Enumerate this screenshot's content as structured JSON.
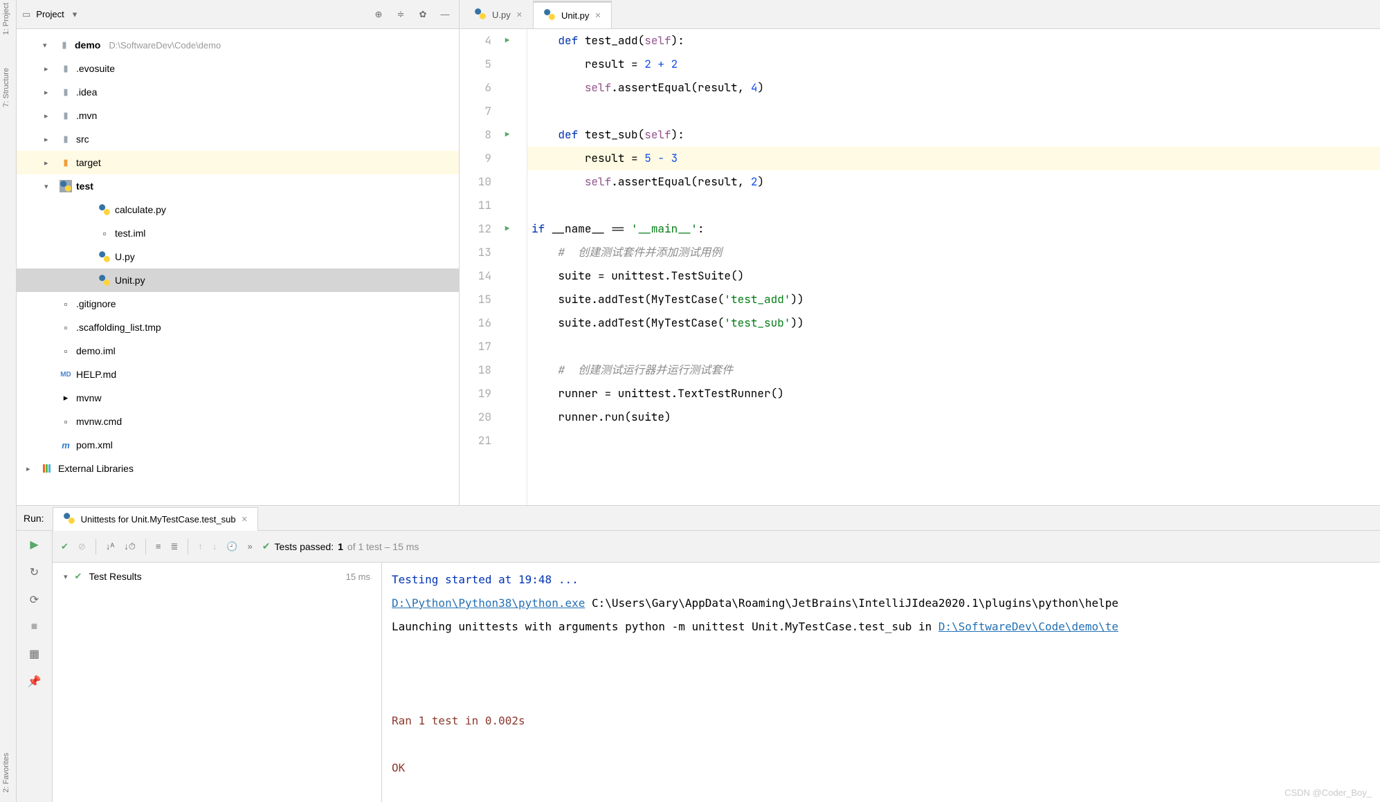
{
  "sidebar_tabs": {
    "project": "1: Project",
    "structure": "7: Structure",
    "favorites": "2: Favorites"
  },
  "project": {
    "toolbar_label": "Project",
    "root": "demo",
    "root_path": "D:\\SoftwareDev\\Code\\demo",
    "dirs": {
      "evosuite": ".evosuite",
      "idea": ".idea",
      "mvn": ".mvn",
      "src": "src",
      "target": "target",
      "test": "test"
    },
    "files": {
      "calculate": "calculate.py",
      "testiml": "test.iml",
      "u": "U.py",
      "unit": "Unit.py",
      "gitignore": ".gitignore",
      "scaffolding": ".scaffolding_list.tmp",
      "demoiml": "demo.iml",
      "help": "HELP.md",
      "mvnw": "mvnw",
      "mvnwcmd": "mvnw.cmd",
      "pom": "pom.xml"
    },
    "ext_libs": "External Libraries"
  },
  "tabs": {
    "u": "U.py",
    "unit": "Unit.py"
  },
  "code": {
    "l4": {
      "def": "def ",
      "name": "test_add",
      "open": "(",
      "self": "self",
      "rest": "):"
    },
    "l5": {
      "txt": "result = ",
      "op": "2 + 2"
    },
    "l6": {
      "self": "self",
      "rest": ".assertEqual(result, ",
      "num": "4",
      "end": ")"
    },
    "l8": {
      "def": "def ",
      "name": "test_sub",
      "open": "(",
      "self": "self",
      "rest": "):"
    },
    "l9": {
      "txt": "result = ",
      "op": "5 - 3"
    },
    "l10": {
      "self": "self",
      "rest": ".assertEqual(result, ",
      "num": "2",
      "end": ")"
    },
    "l12": {
      "if": "if ",
      "name": "__name__ == ",
      "str": "'__main__'",
      "colon": ":"
    },
    "l13": "#  创建测试套件并添加测试用例",
    "l14": "suite = unittest.TestSuite()",
    "l15": {
      "pre": "suite.addTest(MyTestCase(",
      "str": "'test_add'",
      "post": "))"
    },
    "l16": {
      "pre": "suite.addTest(MyTestCase(",
      "str": "'test_sub'",
      "post": "))"
    },
    "l18": "#  创建测试运行器并运行测试套件",
    "l19": "runner = unittest.TextTestRunner()",
    "l20": "runner.run(suite)"
  },
  "lines": {
    "4": "4",
    "5": "5",
    "6": "6",
    "7": "7",
    "8": "8",
    "9": "9",
    "10": "10",
    "11": "11",
    "12": "12",
    "13": "13",
    "14": "14",
    "15": "15",
    "16": "16",
    "17": "17",
    "18": "18",
    "19": "19",
    "20": "20",
    "21": "21"
  },
  "run": {
    "label": "Run:",
    "tab": "Unittests for Unit.MyTestCase.test_sub",
    "status": {
      "pre": "Tests passed: ",
      "num": "1",
      "rest": " of 1 test – 15 ms"
    },
    "tree": {
      "root": "Test Results",
      "time": "15 ms"
    },
    "console": {
      "l1": "Testing started at 19:48 ...",
      "l2a": "D:\\Python\\Python38\\python.exe",
      "l2b": " C:\\Users\\Gary\\AppData\\Roaming\\JetBrains\\IntelliJIdea2020.1\\plugins\\python\\helpe",
      "l3a": "Launching unittests with arguments python -m unittest Unit.MyTestCase.test_sub in ",
      "l3b": "D:\\SoftwareDev\\Code\\demo\\te",
      "l4": "Ran 1 test in 0.002s",
      "l5": "OK"
    }
  },
  "watermark": "CSDN @Coder_Boy_"
}
